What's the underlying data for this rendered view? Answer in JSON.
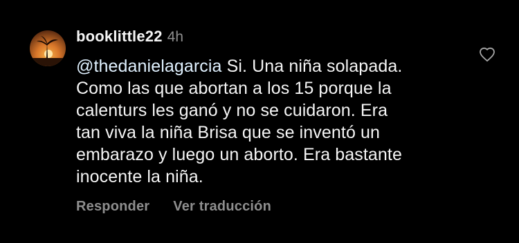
{
  "comment": {
    "username": "booklittle22",
    "timestamp": "4h",
    "mention": "@thedanielagarcia",
    "lines": [
      " Si. Una niña solapada.",
      "Como las que abortan a los 15 porque la",
      "calenturs les ganó y no se cuidaron. Era",
      "tan viva la niña Brisa que se inventó un",
      "embarazo y luego un aborto. Era bastante",
      "inocente la niña."
    ],
    "actions": {
      "reply": "Responder",
      "translate": "Ver traducción"
    },
    "icons": {
      "avatar": "avatar-sunset-image",
      "like": "heart-outline-icon"
    }
  },
  "colors": {
    "background": "#000000",
    "text": "#f5f5f5",
    "mention": "#e0f1ff",
    "secondary": "#8e8e8e"
  }
}
